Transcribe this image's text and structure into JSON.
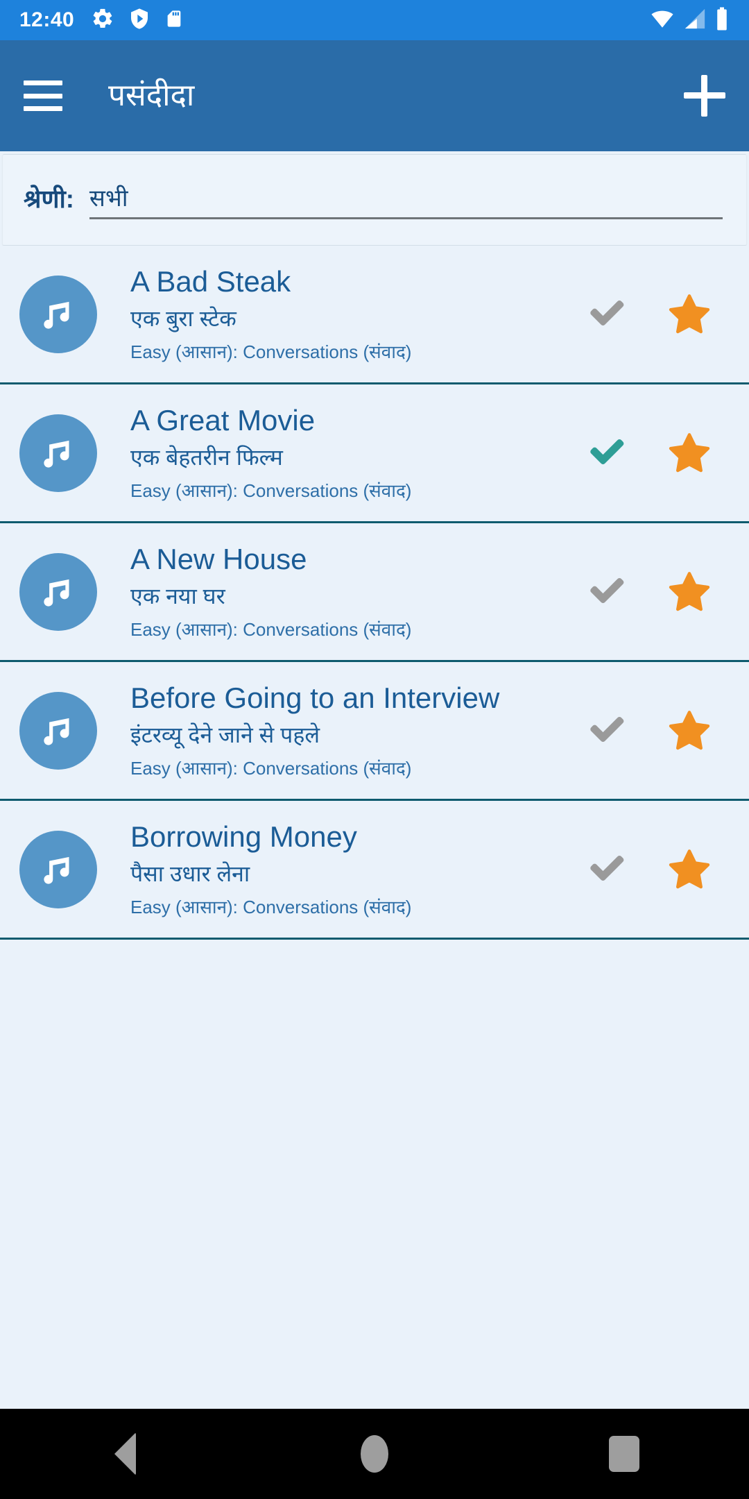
{
  "status_bar": {
    "time": "12:40",
    "left_icons": [
      "gear-icon",
      "shield-play-icon",
      "sd-card-icon"
    ],
    "right_icons": [
      "wifi-icon",
      "cellular-signal-icon",
      "battery-icon"
    ],
    "background_color": "#1E82DC"
  },
  "app_bar": {
    "menu_icon": "hamburger-menu-icon",
    "title": "पसंदीदा",
    "add_icon": "plus-icon",
    "background_color": "#2A6CA8"
  },
  "filter": {
    "label": "श्रेणी:",
    "selected_value": "सभी",
    "placeholder": "सभी"
  },
  "list": {
    "items": [
      {
        "title": "A Bad Steak",
        "subtitle": "एक बुरा स्टेक",
        "meta": "Easy (आसान): Conversations (संवाद)",
        "avatar_icon": "music-note-icon",
        "check_state": "unchecked",
        "check_color": "#9A9A9A",
        "star_state": "starred",
        "star_color": "#F19021"
      },
      {
        "title": "A Great Movie",
        "subtitle": "एक बेहतरीन फिल्म",
        "meta": "Easy (आसान): Conversations (संवाद)",
        "avatar_icon": "music-note-icon",
        "check_state": "checked",
        "check_color": "#2E9E96",
        "star_state": "starred",
        "star_color": "#F19021"
      },
      {
        "title": "A New House",
        "subtitle": "एक नया घर",
        "meta": "Easy (आसान): Conversations (संवाद)",
        "avatar_icon": "music-note-icon",
        "check_state": "unchecked",
        "check_color": "#9A9A9A",
        "star_state": "starred",
        "star_color": "#F19021"
      },
      {
        "title": "Before Going to an Interview",
        "subtitle": "इंटरव्यू देने जाने से पहले",
        "meta": "Easy (आसान): Conversations (संवाद)",
        "avatar_icon": "music-note-icon",
        "check_state": "unchecked",
        "check_color": "#9A9A9A",
        "star_state": "starred",
        "star_color": "#F19021"
      },
      {
        "title": "Borrowing Money",
        "subtitle": "पैसा उधार लेना",
        "meta": "Easy (आसान): Conversations (संवाद)",
        "avatar_icon": "music-note-icon",
        "check_state": "unchecked",
        "check_color": "#9A9A9A",
        "star_state": "starred",
        "star_color": "#F19021"
      }
    ]
  },
  "nav_bar": {
    "back_icon": "back-triangle-icon",
    "home_icon": "home-circle-icon",
    "recents_icon": "recents-square-icon"
  },
  "theme": {
    "primary": "#2A6CA8",
    "status": "#1E82DC",
    "page_background": "#EAF2FA",
    "title_text": "#1B5C96",
    "avatar": "#5596C8",
    "divider": "#0E5B6E"
  }
}
